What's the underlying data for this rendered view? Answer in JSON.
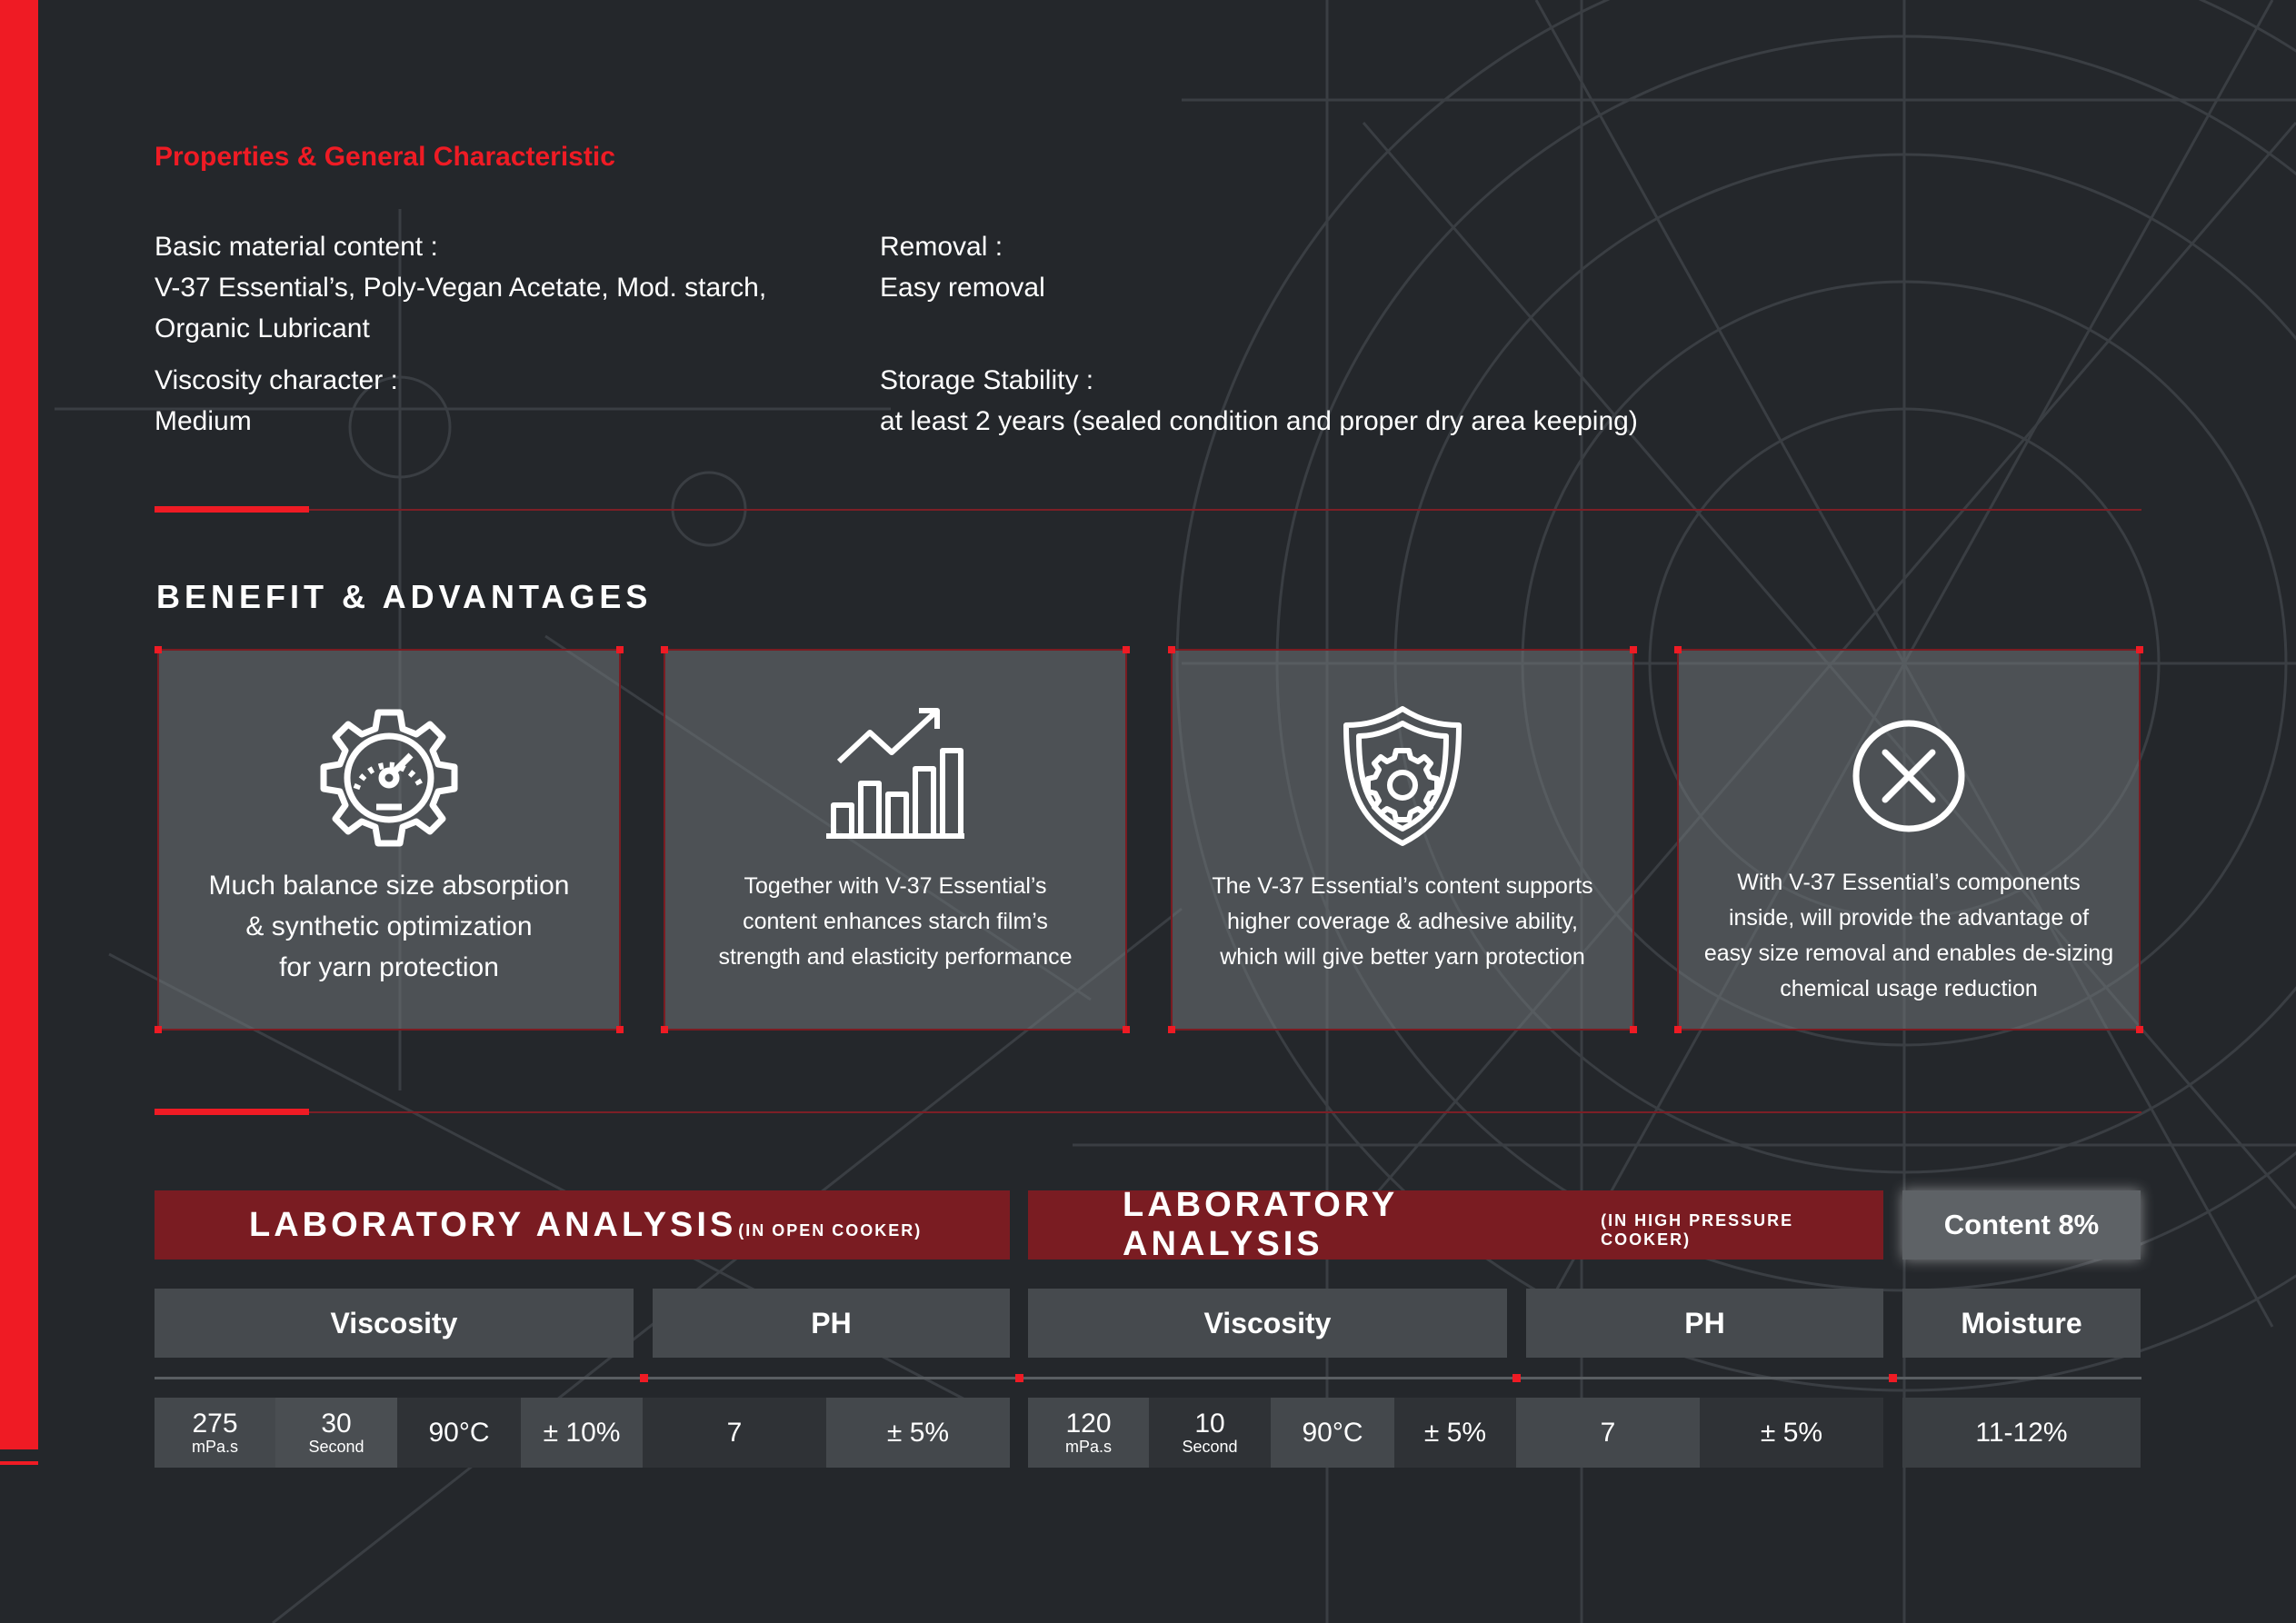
{
  "colors": {
    "accent": "#ef1b24",
    "background": "#24272b",
    "card": "#5a5e62",
    "header": "#7a1c22"
  },
  "properties": {
    "title": "Properties & General Characteristic",
    "basic_material": {
      "label": "Basic material content :",
      "value_line1": "V-37 Essential’s, Poly-Vegan Acetate, Mod. starch,",
      "value_line2": "Organic Lubricant"
    },
    "viscosity": {
      "label": "Viscosity character :",
      "value": "Medium"
    },
    "removal": {
      "label": "Removal :",
      "value": "Easy removal"
    },
    "storage": {
      "label": "Storage Stability :",
      "value": "at least 2 years (sealed condition and proper dry area keeping)"
    }
  },
  "benefits": {
    "heading": "BENEFIT & ADVANTAGES",
    "cards": [
      {
        "icon": "gear-gauge-icon",
        "lines": [
          "Much balance size absorption",
          "& synthetic optimization",
          "for yarn protection"
        ]
      },
      {
        "icon": "growth-chart-icon",
        "lines": [
          "Together with V-37 Essential’s",
          "content enhances starch film’s",
          "strength and elasticity performance"
        ]
      },
      {
        "icon": "shield-gear-icon",
        "lines": [
          "The V-37 Essential’s content supports",
          "higher coverage & adhesive ability,",
          "which will give better yarn protection"
        ]
      },
      {
        "icon": "close-circle-icon",
        "lines": [
          "With V-37 Essential’s components",
          "inside, will provide the advantage of",
          "easy size removal and enables de-sizing",
          "chemical usage reduction"
        ]
      }
    ]
  },
  "lab": {
    "open": {
      "title": "LABORATORY ANALYSIS",
      "subtitle": "(IN OPEN COOKER)",
      "viscosity_label": "Viscosity",
      "ph_label": "PH",
      "viscosity_value": "275",
      "viscosity_unit": "mPa.s",
      "time_value": "30",
      "time_unit": "Second",
      "temperature": "90°C",
      "viscosity_tolerance": "± 10%",
      "ph_value": "7",
      "ph_tolerance": "± 5%"
    },
    "pressure": {
      "title": "LABORATORY ANALYSIS",
      "subtitle": "(IN HIGH PRESSURE COOKER)",
      "viscosity_label": "Viscosity",
      "ph_label": "PH",
      "viscosity_value": "120",
      "viscosity_unit": "mPa.s",
      "time_value": "10",
      "time_unit": "Second",
      "temperature": "90°C",
      "viscosity_tolerance": "± 5%",
      "ph_value": "7",
      "ph_tolerance": "± 5%"
    },
    "content": {
      "label": "Content 8%",
      "moisture_label": "Moisture",
      "moisture_value": "11-12%"
    }
  }
}
